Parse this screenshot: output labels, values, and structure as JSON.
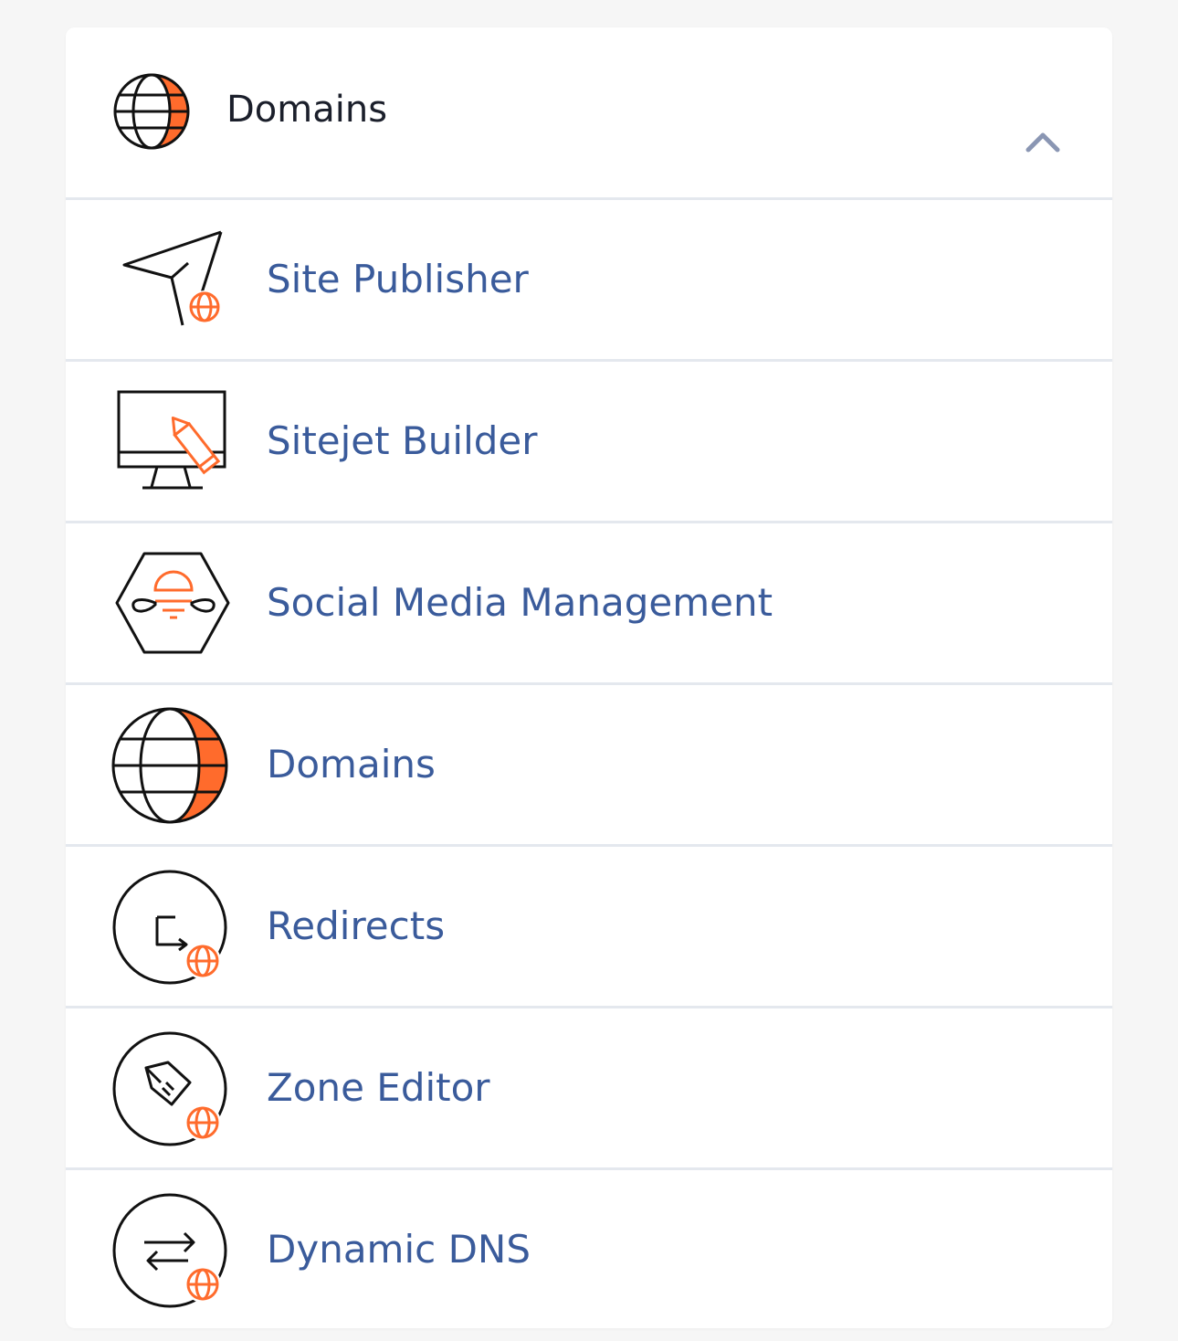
{
  "section": {
    "title": "Domains",
    "header_icon": "globe-icon",
    "toggle_icon": "chevron-up-icon",
    "expanded": true
  },
  "items": [
    {
      "label": "Site Publisher",
      "icon": "paper-plane-globe-icon"
    },
    {
      "label": "Sitejet Builder",
      "icon": "monitor-pencil-icon"
    },
    {
      "label": "Social Media Management",
      "icon": "hexagon-sitejet-icon"
    },
    {
      "label": "Domains",
      "icon": "globe-icon"
    },
    {
      "label": "Redirects",
      "icon": "redirect-arrow-globe-icon"
    },
    {
      "label": "Zone Editor",
      "icon": "pen-nib-globe-icon"
    },
    {
      "label": "Dynamic DNS",
      "icon": "swap-arrows-globe-icon"
    }
  ],
  "colors": {
    "accent": "#ff6b2c",
    "link": "#3a5b9b",
    "title": "#1b1f2b",
    "divider": "#e4e8ee",
    "chevron": "#8a96b3"
  }
}
